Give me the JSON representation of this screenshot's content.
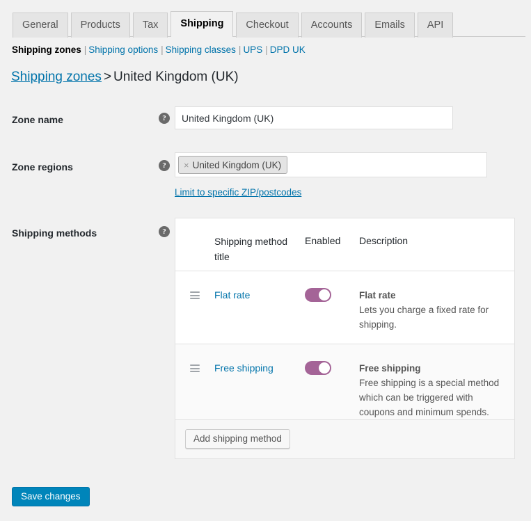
{
  "tabs": [
    {
      "label": "General",
      "active": false
    },
    {
      "label": "Products",
      "active": false
    },
    {
      "label": "Tax",
      "active": false
    },
    {
      "label": "Shipping",
      "active": true
    },
    {
      "label": "Checkout",
      "active": false
    },
    {
      "label": "Accounts",
      "active": false
    },
    {
      "label": "Emails",
      "active": false
    },
    {
      "label": "API",
      "active": false
    }
  ],
  "subnav": [
    {
      "label": "Shipping zones",
      "current": true
    },
    {
      "label": "Shipping options",
      "current": false
    },
    {
      "label": "Shipping classes",
      "current": false
    },
    {
      "label": "UPS",
      "current": false
    },
    {
      "label": "DPD UK",
      "current": false
    }
  ],
  "subnav_separator": "|",
  "breadcrumb": {
    "parent_link": "Shipping zones",
    "separator": ">",
    "current": "United Kingdom (UK)"
  },
  "form": {
    "zone_name": {
      "label": "Zone name",
      "help_icon": "question-mark-icon",
      "value": "United Kingdom (UK)",
      "placeholder": "Zone name"
    },
    "zone_regions": {
      "label": "Zone regions",
      "help_icon": "question-mark-icon",
      "tokens": [
        {
          "label": "United Kingdom (UK)",
          "remove_icon": "×"
        }
      ],
      "zip_link": "Limit to specific ZIP/postcodes"
    },
    "shipping_methods": {
      "label": "Shipping methods",
      "help_icon": "question-mark-icon",
      "columns": {
        "handle": "",
        "title": "Shipping method title",
        "enabled": "Enabled",
        "description": "Description"
      },
      "rows": [
        {
          "handle_icon": "drag-handle-icon",
          "title": "Flat rate",
          "enabled": true,
          "desc_title": "Flat rate",
          "desc_body": "Lets you charge a fixed rate for shipping."
        },
        {
          "handle_icon": "drag-handle-icon",
          "title": "Free shipping",
          "enabled": true,
          "desc_title": "Free shipping",
          "desc_body": "Free shipping is a special method which can be triggered with coupons and minimum spends."
        }
      ],
      "add_button": "Add shipping method"
    }
  },
  "actions": {
    "save_label": "Save changes"
  },
  "colors": {
    "page_bg": "#f1f1f1",
    "link": "#0073aa",
    "primary_button": "#0085ba",
    "toggle_on": "#a46497",
    "tab_inactive_bg": "#e5e5e5",
    "table_border": "#e1e1e1",
    "alt_row_bg": "#fafafa"
  }
}
